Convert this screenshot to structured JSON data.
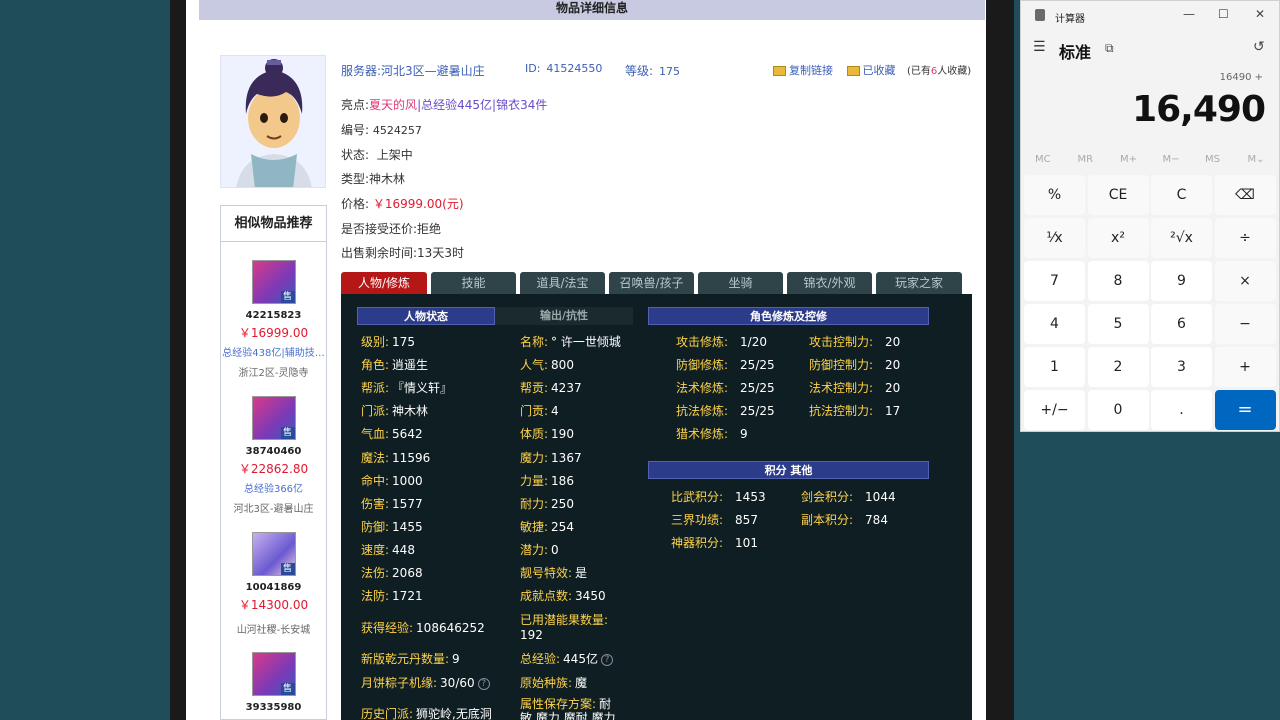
{
  "page": {
    "title": "物品详细信息"
  },
  "header": {
    "server_label": "服务器:",
    "server_value": "河北3区—避暑山庄",
    "id_label": "ID:",
    "id_value": "41524550",
    "level_label": "等级:",
    "level_value": "175",
    "copy_link": "复制链接",
    "favorited": "已收藏",
    "fav_count_text_prefix": "(已有",
    "fav_count": "6",
    "fav_count_text_suffix": "人收藏)"
  },
  "details": {
    "highlight_label": "亮点:",
    "highlight_1": "夏天的风",
    "highlight_2": "总经验445亿",
    "highlight_3": "锦衣34件",
    "number_label": "编号:",
    "number_value": "4524257",
    "status_label": "状态:",
    "status_value": "上架中",
    "type_label": "类型:",
    "type_value": "神木林",
    "price_label": "价格:",
    "price_value": "￥16999.00(元)",
    "counter_label": "是否接受还价:",
    "counter_value": "拒绝",
    "remaining_label": "出售剩余时间:",
    "remaining_value": "13天3时"
  },
  "sidebar": {
    "title": "相似物品推荐",
    "sale_badge": "售",
    "items": [
      {
        "id": "42215823",
        "price": "￥16999.00",
        "highlight": "总经验438亿|辅助技…",
        "server": "浙江2区-灵隐寺"
      },
      {
        "id": "38740460",
        "price": "￥22862.80",
        "highlight": "总经验366亿",
        "server": "河北3区-避暑山庄"
      },
      {
        "id": "10041869",
        "price": "￥14300.00",
        "highlight": "",
        "server": "山河社稷-长安城"
      },
      {
        "id": "39335980",
        "price": "",
        "highlight": "",
        "server": ""
      }
    ]
  },
  "tabs": [
    "人物/修炼",
    "技能",
    "道具/法宝",
    "召唤兽/孩子",
    "坐骑",
    "锦衣/外观",
    "玩家之家"
  ],
  "panel": {
    "status_head": "人物状态",
    "output_head": "输出/抗性",
    "cultivation_head": "角色修炼及控修",
    "points_head": "积分 其他",
    "left_col": [
      {
        "k": "级别:",
        "v": "175"
      },
      {
        "k": "角色:",
        "v": "逍遥生"
      },
      {
        "k": "帮派:",
        "v": "『情义轩』"
      },
      {
        "k": "门派:",
        "v": "神木林"
      },
      {
        "k": "气血:",
        "v": "5642"
      },
      {
        "k": "魔法:",
        "v": "11596"
      },
      {
        "k": "命中:",
        "v": "1000"
      },
      {
        "k": "伤害:",
        "v": "1577"
      },
      {
        "k": "防御:",
        "v": "1455"
      },
      {
        "k": "速度:",
        "v": "448"
      },
      {
        "k": "法伤:",
        "v": "2068"
      },
      {
        "k": "法防:",
        "v": "1721"
      }
    ],
    "mid_col": [
      {
        "k": "名称:",
        "v": "° 许一世倾城"
      },
      {
        "k": "人气:",
        "v": "800"
      },
      {
        "k": "帮贡:",
        "v": "4237"
      },
      {
        "k": "门贡:",
        "v": "4"
      },
      {
        "k": "体质:",
        "v": "190"
      },
      {
        "k": "魔力:",
        "v": "1367"
      },
      {
        "k": "力量:",
        "v": "186"
      },
      {
        "k": "耐力:",
        "v": "250"
      },
      {
        "k": "敏捷:",
        "v": "254"
      },
      {
        "k": "潜力:",
        "v": "0"
      },
      {
        "k": "靓号特效:",
        "v": "是"
      },
      {
        "k": "成就点数:",
        "v": "3450"
      }
    ],
    "exp_label": "获得经验:",
    "exp_value": "108646252",
    "used_label": "已用潜能果数量:",
    "used_value": "192",
    "qyd_label": "新版乾元丹数量:",
    "qyd_value": "9",
    "total_exp_label": "总经验:",
    "total_exp_value": "445亿",
    "zongzi_label": "月饼粽子机缘:",
    "zongzi_value": "30/60",
    "race_label": "原始种族:",
    "race_value": "魔",
    "history_label": "历史门派:",
    "history_value": "狮驼岭,无底洞",
    "attr_label": "属性保存方案:",
    "attr_value": "耐",
    "attr_value2": "敏 魔力 魔耐 魔力",
    "qmark": "?",
    "cult_left": [
      {
        "k": "攻击修炼:",
        "v": "1/20"
      },
      {
        "k": "防御修炼:",
        "v": "25/25"
      },
      {
        "k": "法术修炼:",
        "v": "25/25"
      },
      {
        "k": "抗法修炼:",
        "v": "25/25"
      },
      {
        "k": "猎术修炼:",
        "v": "9"
      }
    ],
    "cult_right": [
      {
        "k": "攻击控制力:",
        "v": "20"
      },
      {
        "k": "防御控制力:",
        "v": "20"
      },
      {
        "k": "法术控制力:",
        "v": "20"
      },
      {
        "k": "抗法控制力:",
        "v": "17"
      }
    ],
    "points": [
      {
        "k": "比武积分:",
        "v": "1453"
      },
      {
        "k": "剑会积分:",
        "v": "1044"
      },
      {
        "k": "三界功绩:",
        "v": "857"
      },
      {
        "k": "副本积分:",
        "v": "784"
      },
      {
        "k": "神器积分:",
        "v": "101"
      }
    ]
  },
  "calculator": {
    "title": "计算器",
    "mode": "标准",
    "expression": "16490 +",
    "display": "16,490",
    "memory": [
      "MC",
      "MR",
      "M+",
      "M−",
      "MS",
      "M⌄"
    ],
    "keys": [
      "%",
      "CE",
      "C",
      "⌫",
      "¹⁄x",
      "x²",
      "²√x",
      "÷",
      "7",
      "8",
      "9",
      "×",
      "4",
      "5",
      "6",
      "−",
      "1",
      "2",
      "3",
      "+",
      "+/−",
      "0",
      ".",
      "="
    ]
  }
}
